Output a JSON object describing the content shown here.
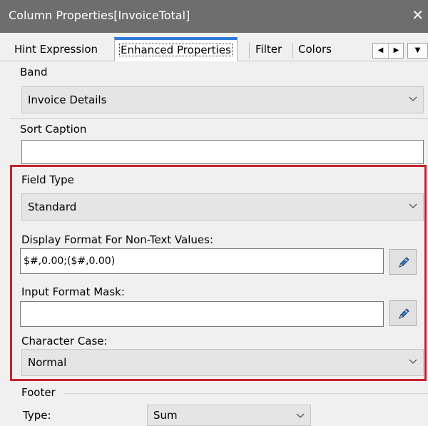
{
  "window": {
    "title": "Column Properties[InvoiceTotal]",
    "close_glyph": "✕"
  },
  "tabs": [
    {
      "label": "Hint Expression",
      "active": false
    },
    {
      "label": "Enhanced Properties",
      "active": true
    },
    {
      "label": "Filter",
      "active": false
    },
    {
      "label": "Colors",
      "active": false
    }
  ],
  "tab_nav": {
    "prev_glyph": "◀",
    "next_glyph": "▶",
    "menu_glyph": "▼"
  },
  "band": {
    "label": "Band",
    "value": "Invoice Details"
  },
  "sort_caption": {
    "label": "Sort Caption",
    "value": ""
  },
  "field_type": {
    "label": "Field Type",
    "value": "Standard"
  },
  "display_format": {
    "label": "Display Format For Non-Text Values:",
    "value": "$#,0.00;($#,0.00)"
  },
  "input_mask": {
    "label": "Input Format Mask:",
    "value": ""
  },
  "character_case": {
    "label": "Character Case:",
    "value": "Normal"
  },
  "footer": {
    "label": "Footer",
    "type_label": "Type:",
    "type_value": "Sum"
  },
  "colors": {
    "title_bar": "#6e6e6e",
    "highlight": "#c8232c",
    "active_tab_accent": "#2f7bd6"
  }
}
